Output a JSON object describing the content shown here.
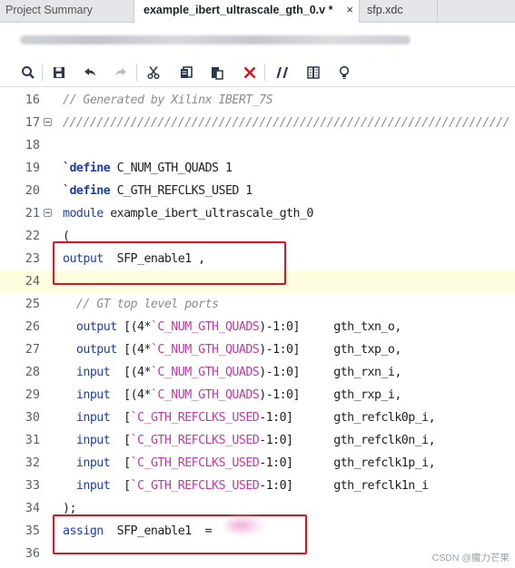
{
  "tabs": [
    {
      "label": "Project Summary",
      "active": false
    },
    {
      "label": "example_ibert_ultrascale_gth_0.v *",
      "active": true,
      "close": "×"
    },
    {
      "label": "sfp.xdc",
      "active": false
    }
  ],
  "path_bar": {
    "text": "(blurred file path)"
  },
  "toolbar": [
    {
      "name": "search-icon"
    },
    {
      "name": "save-icon"
    },
    {
      "name": "undo-icon"
    },
    {
      "name": "redo-icon"
    },
    {
      "name": "cut-icon"
    },
    {
      "name": "copy-icon"
    },
    {
      "name": "paste-icon"
    },
    {
      "name": "delete-icon"
    },
    {
      "name": "comment-icon"
    },
    {
      "name": "column-icon"
    },
    {
      "name": "bulb-icon"
    }
  ],
  "editor": {
    "lines": [
      {
        "num": "16",
        "code": "// Generated by Xilinx IBERT_7S"
      },
      {
        "num": "17",
        "code": "//////////////////////////////////////////////////////////////////",
        "fold": true
      },
      {
        "num": "18",
        "code": ""
      },
      {
        "num": "19",
        "code": "`define C_NUM_GTH_QUADS 1"
      },
      {
        "num": "20",
        "code": "`define C_GTH_REFCLKS_USED 1"
      },
      {
        "num": "21",
        "code": "module example_ibert_ultrascale_gth_0",
        "fold": true
      },
      {
        "num": "22",
        "code": "("
      },
      {
        "num": "23",
        "code": "output  SFP_enable1 ,"
      },
      {
        "num": "24",
        "code": ""
      },
      {
        "num": "25",
        "code": "  // GT top level ports"
      },
      {
        "num": "26",
        "code": "  output [(4*`C_NUM_GTH_QUADS)-1:0]     gth_txn_o,"
      },
      {
        "num": "27",
        "code": "  output [(4*`C_NUM_GTH_QUADS)-1:0]     gth_txp_o,"
      },
      {
        "num": "28",
        "code": "  input  [(4*`C_NUM_GTH_QUADS)-1:0]     gth_rxn_i,"
      },
      {
        "num": "29",
        "code": "  input  [(4*`C_NUM_GTH_QUADS)-1:0]     gth_rxp_i,"
      },
      {
        "num": "30",
        "code": "  input  [`C_GTH_REFCLKS_USED-1:0]      gth_refclk0p_i,"
      },
      {
        "num": "31",
        "code": "  input  [`C_GTH_REFCLKS_USED-1:0]      gth_refclk0n_i,"
      },
      {
        "num": "32",
        "code": "  input  [`C_GTH_REFCLKS_USED-1:0]      gth_refclk1p_i,"
      },
      {
        "num": "33",
        "code": "  input  [`C_GTH_REFCLKS_USED-1:0]      gth_refclk1n_i"
      },
      {
        "num": "34",
        "code": ");"
      },
      {
        "num": "35",
        "code": "assign  SFP_enable1  =  "
      },
      {
        "num": "36",
        "code": ""
      }
    ]
  },
  "watermark": "CSDN @魔力芒果",
  "colors": {
    "keyword": "#1f3fa8",
    "macro": "#c03aa8",
    "comment": "#8c8c8c",
    "highlight": "#e01020"
  }
}
